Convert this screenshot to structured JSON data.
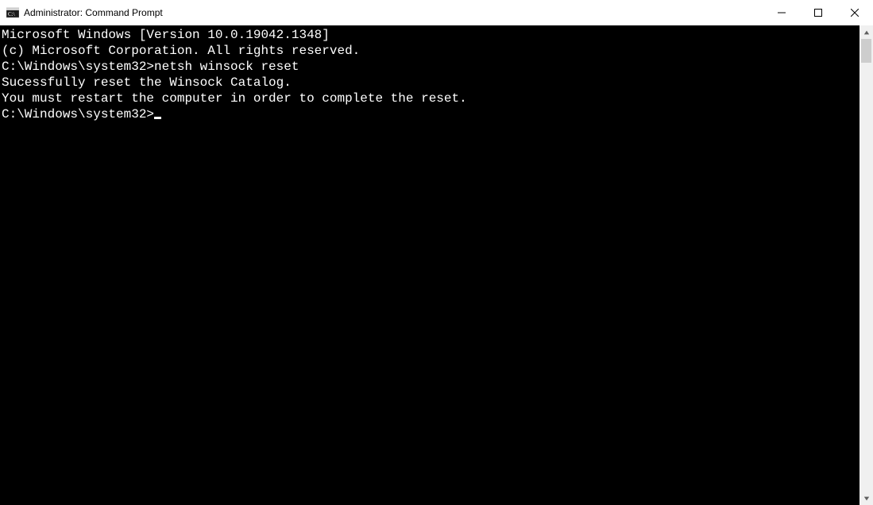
{
  "window": {
    "title": "Administrator: Command Prompt"
  },
  "terminal": {
    "line1": "Microsoft Windows [Version 10.0.19042.1348]",
    "line2": "(c) Microsoft Corporation. All rights reserved.",
    "blank1": "",
    "prompt1": "C:\\Windows\\system32>",
    "command1": "netsh winsock reset",
    "blank2": "",
    "output1": "Sucessfully reset the Winsock Catalog.",
    "output2": "You must restart the computer in order to complete the reset.",
    "blank3": "",
    "blank4": "",
    "prompt2": "C:\\Windows\\system32>"
  }
}
